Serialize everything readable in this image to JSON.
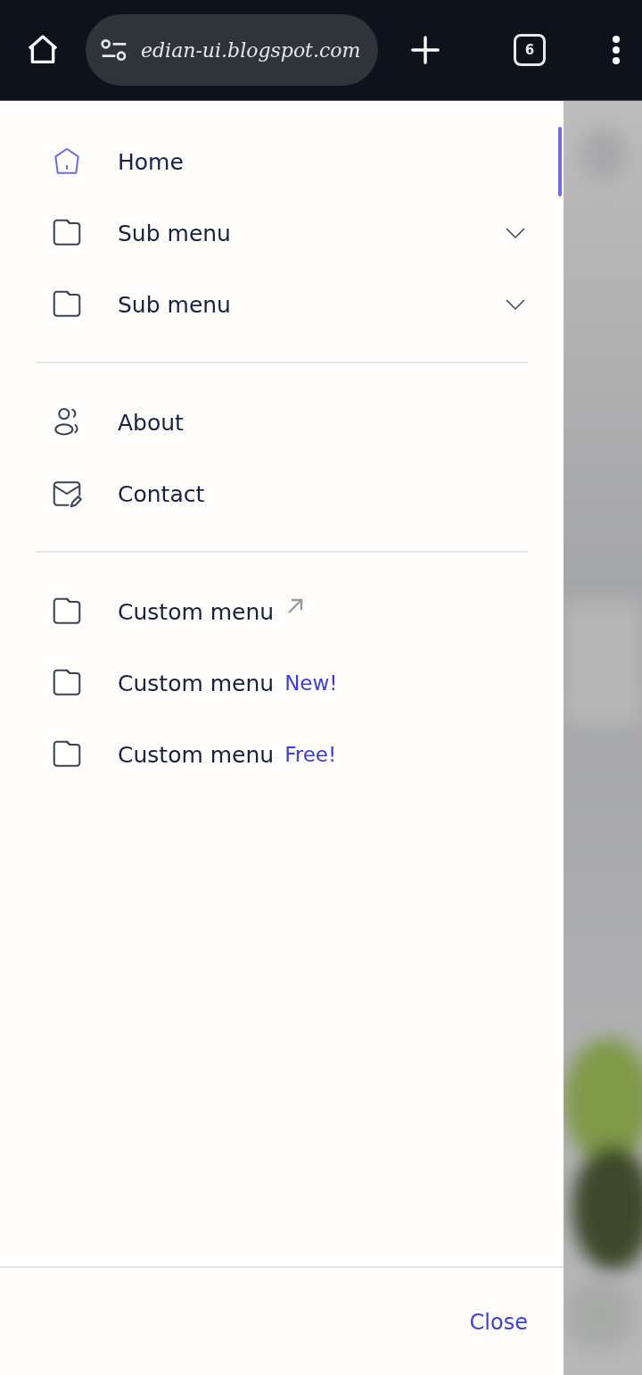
{
  "browser_bar": {
    "url": "edian-ui.blogspot.com",
    "tab_count": "6"
  },
  "drawer": {
    "sections": [
      {
        "items": [
          {
            "kind": "link",
            "label": "Home",
            "selected": true
          },
          {
            "kind": "submenu",
            "label": "Sub menu",
            "selected": false,
            "expanded": false
          },
          {
            "kind": "submenu",
            "label": "Sub menu",
            "selected": false,
            "expanded": false
          }
        ]
      },
      {
        "items": [
          {
            "kind": "link",
            "label": "About",
            "selected": false
          },
          {
            "kind": "link",
            "label": "Contact",
            "selected": false
          }
        ]
      },
      {
        "items": [
          {
            "kind": "external",
            "label": "Custom menu",
            "selected": false
          },
          {
            "kind": "badge",
            "label": "Custom menu",
            "badge": "New!",
            "selected": false
          },
          {
            "kind": "badge",
            "label": "Custom menu",
            "badge": "Free!",
            "selected": false
          }
        ]
      }
    ],
    "close": "Close"
  }
}
